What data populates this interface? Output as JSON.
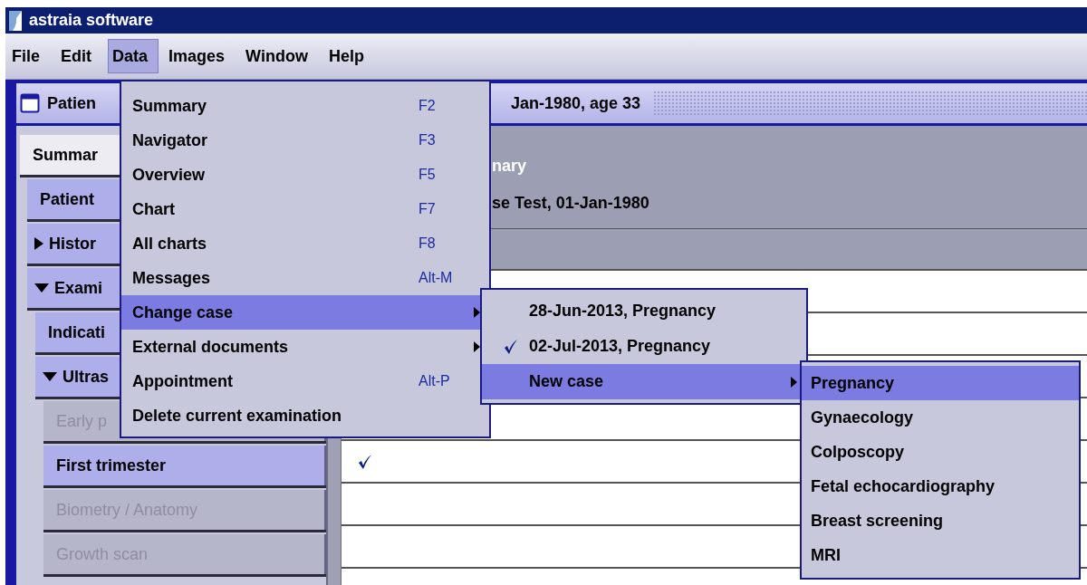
{
  "window": {
    "title": "astraia software"
  },
  "menubar": [
    {
      "label": "File",
      "selected": false
    },
    {
      "label": "Edit",
      "selected": false
    },
    {
      "label": "Data",
      "selected": true
    },
    {
      "label": "Images",
      "selected": false
    },
    {
      "label": "Window",
      "selected": false
    },
    {
      "label": "Help",
      "selected": false
    }
  ],
  "frame": {
    "title_start": "Patien",
    "title_end": "Jan-1980, age 33"
  },
  "sidebar": {
    "items": [
      {
        "label": "Summar",
        "selected": true,
        "disabled": false
      },
      {
        "label": "Patient",
        "selected": false,
        "disabled": false
      },
      {
        "label": "Histor",
        "selected": false,
        "disabled": false,
        "expanded": false
      },
      {
        "label": "Exami",
        "selected": false,
        "disabled": false,
        "expanded": true,
        "children": [
          {
            "label": "Indicati",
            "selected": false,
            "disabled": false
          },
          {
            "label": "Ultras",
            "selected": false,
            "disabled": false,
            "expanded": true,
            "children": [
              {
                "label": "Early p",
                "selected": false,
                "disabled": true
              },
              {
                "label": "First trimester",
                "selected": false,
                "disabled": false
              },
              {
                "label": "Biometry / Anatomy",
                "selected": false,
                "disabled": true
              },
              {
                "label": "Growth scan",
                "selected": false,
                "disabled": true
              }
            ]
          }
        ]
      }
    ]
  },
  "header": {
    "title": "nary",
    "subtitle": "se Test, 01-Jan-1980"
  },
  "rows": [
    {
      "checked": true
    },
    {
      "checked": false
    },
    {
      "checked": false
    }
  ],
  "data_menu": [
    {
      "label": "Summary",
      "shortcut": "F2",
      "selected": false,
      "kind": "item"
    },
    {
      "label": "Navigator",
      "shortcut": "F3",
      "selected": false,
      "kind": "item"
    },
    {
      "label": "Overview",
      "shortcut": "F5",
      "selected": false,
      "kind": "item"
    },
    {
      "label": "Chart",
      "shortcut": "F7",
      "selected": false,
      "kind": "item"
    },
    {
      "label": "All charts",
      "shortcut": "F8",
      "selected": false,
      "kind": "item"
    },
    {
      "label": "Messages",
      "shortcut": "Alt-M",
      "selected": false,
      "kind": "item"
    },
    {
      "label": "Change case",
      "selected": true,
      "kind": "submenu"
    },
    {
      "label": "External documents",
      "selected": false,
      "kind": "submenu"
    },
    {
      "label": "Appointment",
      "shortcut": "Alt-P",
      "selected": false,
      "kind": "item"
    },
    {
      "label": "Delete current examination",
      "selected": false,
      "kind": "item"
    }
  ],
  "change_case_menu": [
    {
      "label": "28-Jun-2013, Pregnancy",
      "checked": false,
      "selected": false,
      "kind": "item"
    },
    {
      "label": "02-Jul-2013, Pregnancy",
      "checked": true,
      "selected": false,
      "kind": "item"
    },
    {
      "label": "New case",
      "checked": false,
      "selected": true,
      "kind": "submenu"
    }
  ],
  "new_case_menu": [
    {
      "label": "Pregnancy",
      "selected": true
    },
    {
      "label": "Gynaecology",
      "selected": false
    },
    {
      "label": "Colposcopy",
      "selected": false
    },
    {
      "label": "Fetal echocardiography",
      "selected": false
    },
    {
      "label": "Breast screening",
      "selected": false
    },
    {
      "label": "MRI",
      "selected": false
    }
  ]
}
